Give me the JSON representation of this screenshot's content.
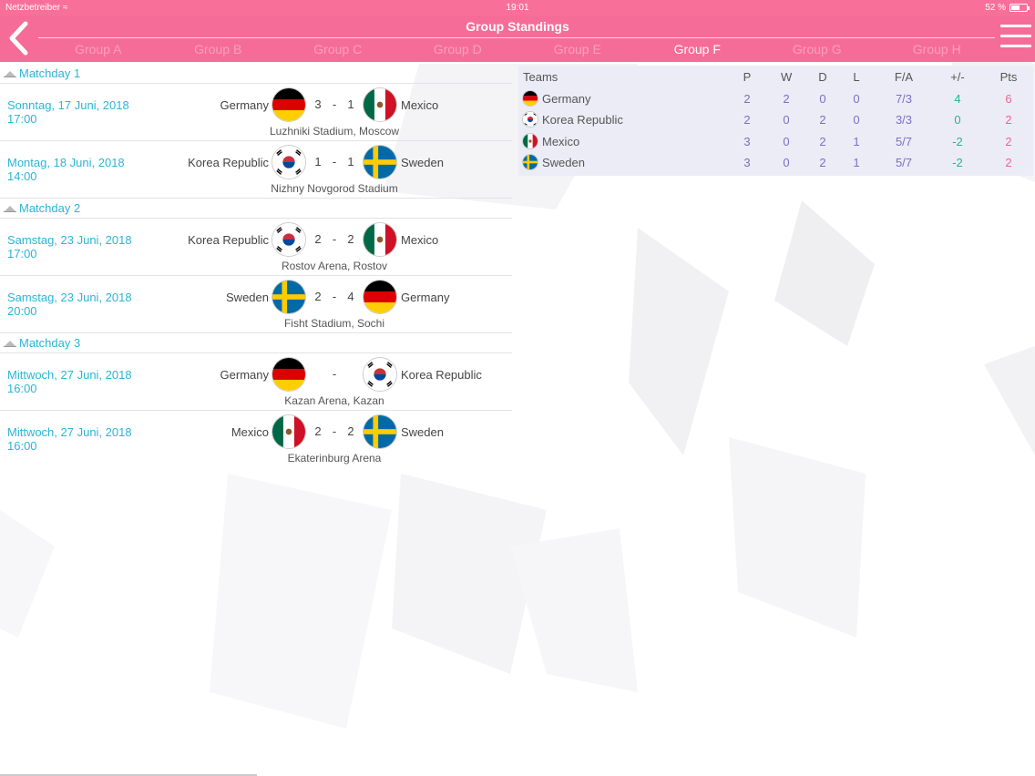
{
  "status": {
    "carrier": "Netzbetreiber",
    "time": "19:01",
    "battery": "52 %"
  },
  "header": {
    "title": "Group Standings",
    "tabs": [
      "Group A",
      "Group B",
      "Group C",
      "Group D",
      "Group E",
      "Group F",
      "Group G",
      "Group H"
    ],
    "active_tab": "Group F"
  },
  "matchdays": [
    {
      "label": "Matchday 1",
      "matches": [
        {
          "date": "Sonntag, 17 Juni, 2018",
          "time": "17:00",
          "home": "Germany",
          "away": "Mexico",
          "home_score": "3",
          "away_score": "1",
          "venue": "Luzhniki Stadium, Moscow"
        },
        {
          "date": "Montag, 18 Juni, 2018",
          "time": "14:00",
          "home": "Korea Republic",
          "away": "Sweden",
          "home_score": "1",
          "away_score": "1",
          "venue": "Nizhny Novgorod Stadium"
        }
      ]
    },
    {
      "label": "Matchday 2",
      "matches": [
        {
          "date": "Samstag, 23 Juni, 2018",
          "time": "17:00",
          "home": "Korea Republic",
          "away": "Mexico",
          "home_score": "2",
          "away_score": "2",
          "venue": "Rostov Arena, Rostov"
        },
        {
          "date": "Samstag, 23 Juni, 2018",
          "time": "20:00",
          "home": "Sweden",
          "away": "Germany",
          "home_score": "2",
          "away_score": "4",
          "venue": "Fisht Stadium, Sochi"
        }
      ]
    },
    {
      "label": "Matchday 3",
      "matches": [
        {
          "date": "Mittwoch, 27 Juni, 2018",
          "time": "16:00",
          "home": "Germany",
          "away": "Korea Republic",
          "home_score": "",
          "away_score": "",
          "venue": "Kazan Arena, Kazan"
        },
        {
          "date": "Mittwoch, 27 Juni, 2018",
          "time": "16:00",
          "home": "Mexico",
          "away": "Sweden",
          "home_score": "2",
          "away_score": "2",
          "venue": "Ekaterinburg Arena"
        }
      ]
    }
  ],
  "score_separator": "-",
  "standings": {
    "headers": {
      "team": "Teams",
      "p": "P",
      "w": "W",
      "d": "D",
      "l": "L",
      "fa": "F/A",
      "gd": "+/-",
      "pts": "Pts"
    },
    "rows": [
      {
        "team": "Germany",
        "p": "2",
        "w": "2",
        "d": "0",
        "l": "0",
        "fa": "7/3",
        "gd": "4",
        "pts": "6"
      },
      {
        "team": "Korea Republic",
        "p": "2",
        "w": "0",
        "d": "2",
        "l": "0",
        "fa": "3/3",
        "gd": "0",
        "pts": "2"
      },
      {
        "team": "Mexico",
        "p": "3",
        "w": "0",
        "d": "2",
        "l": "1",
        "fa": "5/7",
        "gd": "-2",
        "pts": "2"
      },
      {
        "team": "Sweden",
        "p": "3",
        "w": "0",
        "d": "2",
        "l": "1",
        "fa": "5/7",
        "gd": "-2",
        "pts": "2"
      }
    ]
  },
  "colors": {
    "header": "#f66c98",
    "accent": "#2bb5d6",
    "points": "#f06292",
    "goal_diff": "#26b58c",
    "stats": "#7a6fc4"
  },
  "icons": {
    "back": "chevron-left-icon",
    "menu": "hamburger-menu-icon",
    "matchday": "collapse-triangle-icon"
  }
}
